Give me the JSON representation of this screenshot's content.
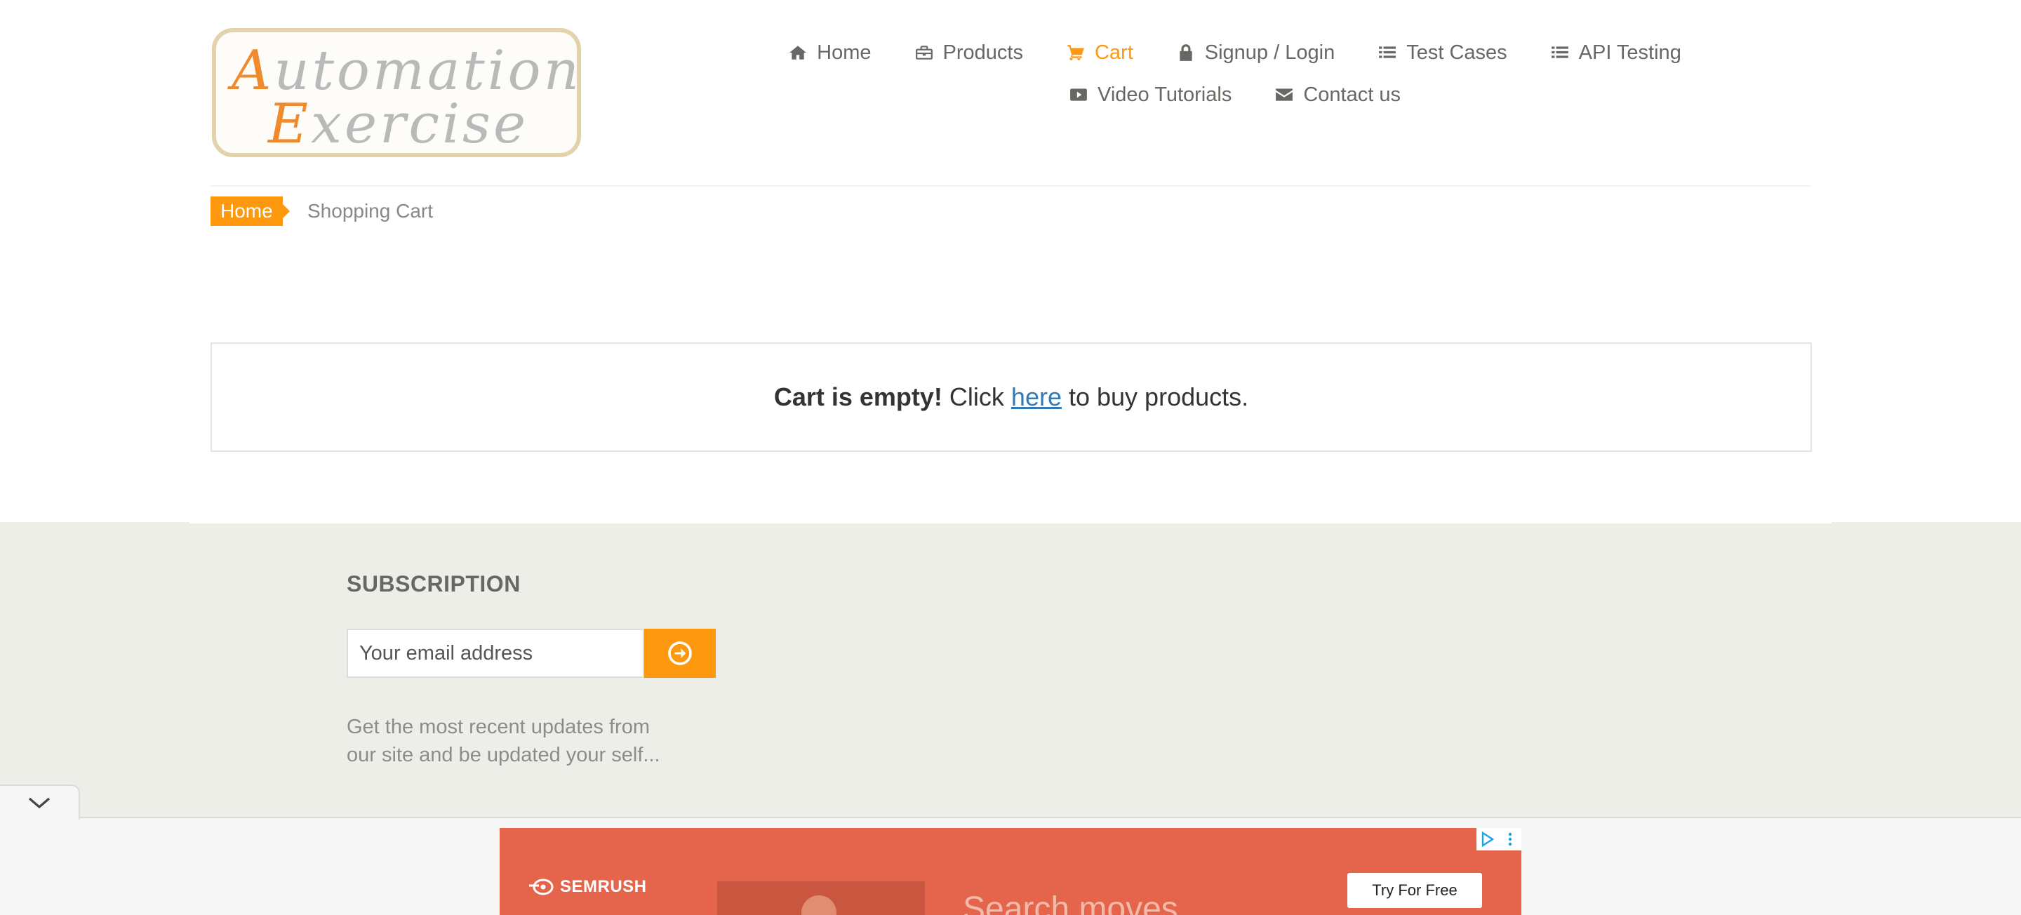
{
  "logo": {
    "line1": "Automation",
    "line2": "Exercise"
  },
  "nav": {
    "row1": [
      {
        "label": "Home",
        "icon": "home-icon"
      },
      {
        "label": "Products",
        "icon": "briefcase-icon"
      },
      {
        "label": "Cart",
        "icon": "cart-icon",
        "active": true
      },
      {
        "label": "Signup / Login",
        "icon": "lock-icon"
      },
      {
        "label": "Test Cases",
        "icon": "list-icon"
      },
      {
        "label": "API Testing",
        "icon": "list-icon"
      }
    ],
    "row2": [
      {
        "label": "Video Tutorials",
        "icon": "youtube-play-icon"
      },
      {
        "label": "Contact us",
        "icon": "envelope-icon"
      }
    ]
  },
  "breadcrumb": {
    "home": "Home",
    "current": "Shopping Cart"
  },
  "cart": {
    "empty_strong": "Cart is empty!",
    "empty_pre": " Click ",
    "link": "here",
    "empty_post": " to buy products."
  },
  "subscription": {
    "title": "SUBSCRIPTION",
    "placeholder": "Your email address",
    "description": "Get the most recent updates from our site and be updated your self..."
  },
  "ad": {
    "brand": "SEMRUSH",
    "headline": "Search moves",
    "cta": "Try For Free"
  },
  "colors": {
    "accent": "#fe980f",
    "footer_bg": "#eeeee9",
    "ad_bg": "#e4654c",
    "link": "#337ab7"
  }
}
